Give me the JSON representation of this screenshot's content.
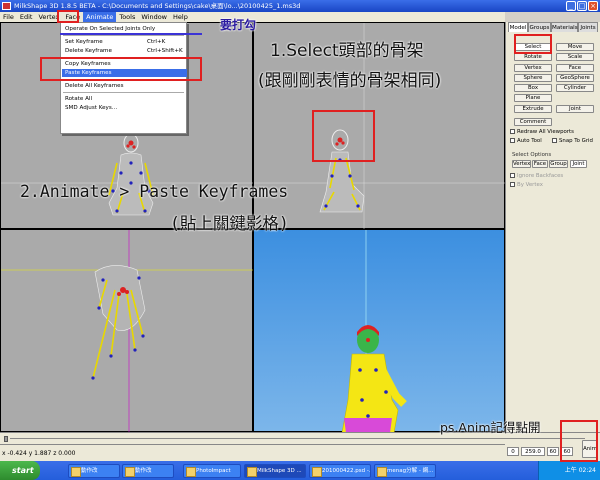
{
  "window": {
    "title": "MilkShape 3D 1.8.5 BETA - C:\\Documents and Settings\\cake\\桌面\\lo...\\20100425_1.ms3d",
    "minimize": "_",
    "maximize": "□",
    "close": "×"
  },
  "menu": [
    "File",
    "Edit",
    "Vertex",
    "Face",
    "Animate",
    "Tools",
    "Window",
    "Help"
  ],
  "animate_menu": [
    {
      "label": "Operate On Selected Joints Only",
      "shortcut": ""
    },
    {
      "label": "Set Keyframe",
      "shortcut": "Ctrl+K"
    },
    {
      "label": "Delete Keyframe",
      "shortcut": "Ctrl+Shift+K"
    },
    {
      "label": "Copy Keyframes",
      "shortcut": ""
    },
    {
      "label": "Paste Keyframes",
      "shortcut": ""
    },
    {
      "label": "Delete All Keyframes",
      "shortcut": ""
    },
    {
      "label": "Rotate All",
      "shortcut": ""
    },
    {
      "label": "SMD Adjust Keys...",
      "shortcut": ""
    }
  ],
  "right_panel": {
    "tabs": [
      "Model",
      "Groups",
      "Materials",
      "Joints"
    ],
    "tools": [
      "Select",
      "Move",
      "Rotate",
      "Scale",
      "Vertex",
      "Face",
      "Sphere",
      "GeoSphere",
      "Box",
      "Cylinder",
      "Plane",
      "Extrude",
      "Joint",
      "Comment"
    ],
    "options": {
      "redraw_all": "Redraw All Viewports",
      "auto_tool": "Auto Tool",
      "snap_grid": "Snap To Grid"
    },
    "select_options_title": "Select Options",
    "select_modes": [
      "Vertex",
      "Face",
      "Group",
      "Joint"
    ],
    "ignore_backfaces": "Ignore Backfaces",
    "by_vertex": "By Vertex"
  },
  "status": {
    "coords": "x -0.424 y 1.887 z 0.000"
  },
  "anim": {
    "frame_start": "0",
    "frame_end": "259.0",
    "fps": "60",
    "total": "60",
    "anim_button": "Anim"
  },
  "taskbar": {
    "start": "start",
    "items": [
      "動作改",
      "動作改",
      "PhotoImpact",
      "MilkShape 3D ...",
      "201000422.psd -...",
      "menag分解 - 網..."
    ],
    "clock": "上午 02:24"
  },
  "annotations": {
    "need_check": "要打勾",
    "step1_line1": "1.Select頭部的骨架",
    "step1_line2": "(跟剛剛表情的骨架相同)",
    "step2_line1": "2.Animate > Paste Keyframes",
    "step2_line2": "(貼上關鍵影格)",
    "ps_note": "ps.Anim記得點開"
  },
  "colors": {
    "annotation_red": "#e02020",
    "xp_blue": "#245edb",
    "viewport_sky": "#3c8fe0"
  }
}
